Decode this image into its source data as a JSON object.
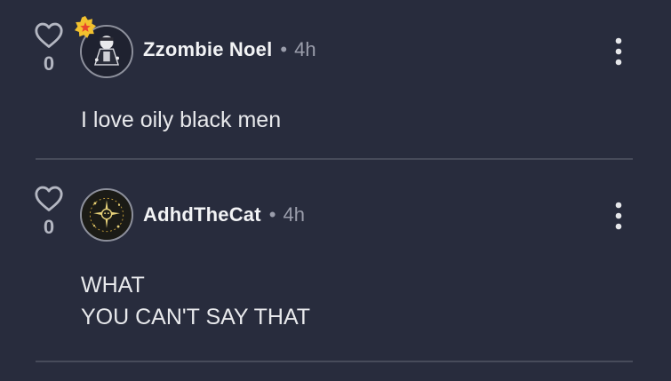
{
  "comments": [
    {
      "username": "Zzombie Noel",
      "separator": "•",
      "time": "4h",
      "likes": "0",
      "has_badge": true,
      "lines": [
        "I love oily black men"
      ]
    },
    {
      "username": "AdhdTheCat",
      "separator": "•",
      "time": "4h",
      "likes": "0",
      "has_badge": false,
      "lines": [
        "WHAT",
        "YOU CAN'T SAY THAT"
      ]
    }
  ],
  "colors": {
    "background": "#282c3d",
    "text": "#e6e7ea",
    "muted": "#9a9dab",
    "divider": "#474b5a",
    "badge": "#f2c12e",
    "badge_star": "#e8452c"
  },
  "icons": [
    "heart-icon",
    "badge-star-icon",
    "more-options-icon"
  ]
}
